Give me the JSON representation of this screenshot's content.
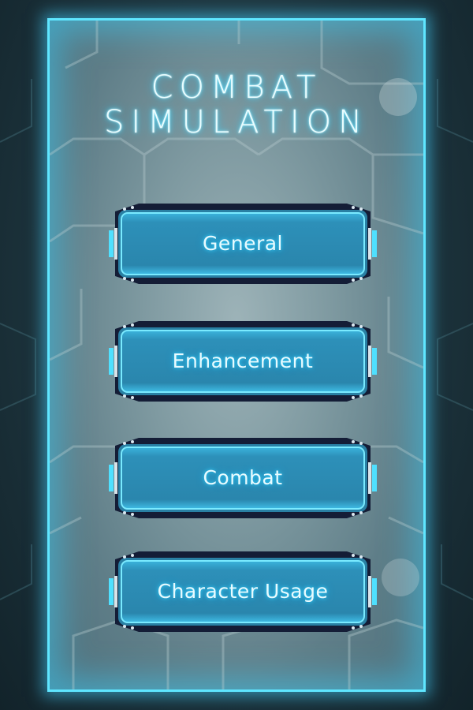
{
  "title": {
    "line1": "COMBAT",
    "line2": "SIMULATION"
  },
  "menu": {
    "items": [
      {
        "label": "General"
      },
      {
        "label": "Enhancement"
      },
      {
        "label": "Combat"
      },
      {
        "label": "Character Usage"
      }
    ]
  },
  "colors": {
    "glow": "#5fe6ff",
    "button_face": "#2b8fb8",
    "frame_dark": "#141d36",
    "text": "#e8fbff"
  }
}
